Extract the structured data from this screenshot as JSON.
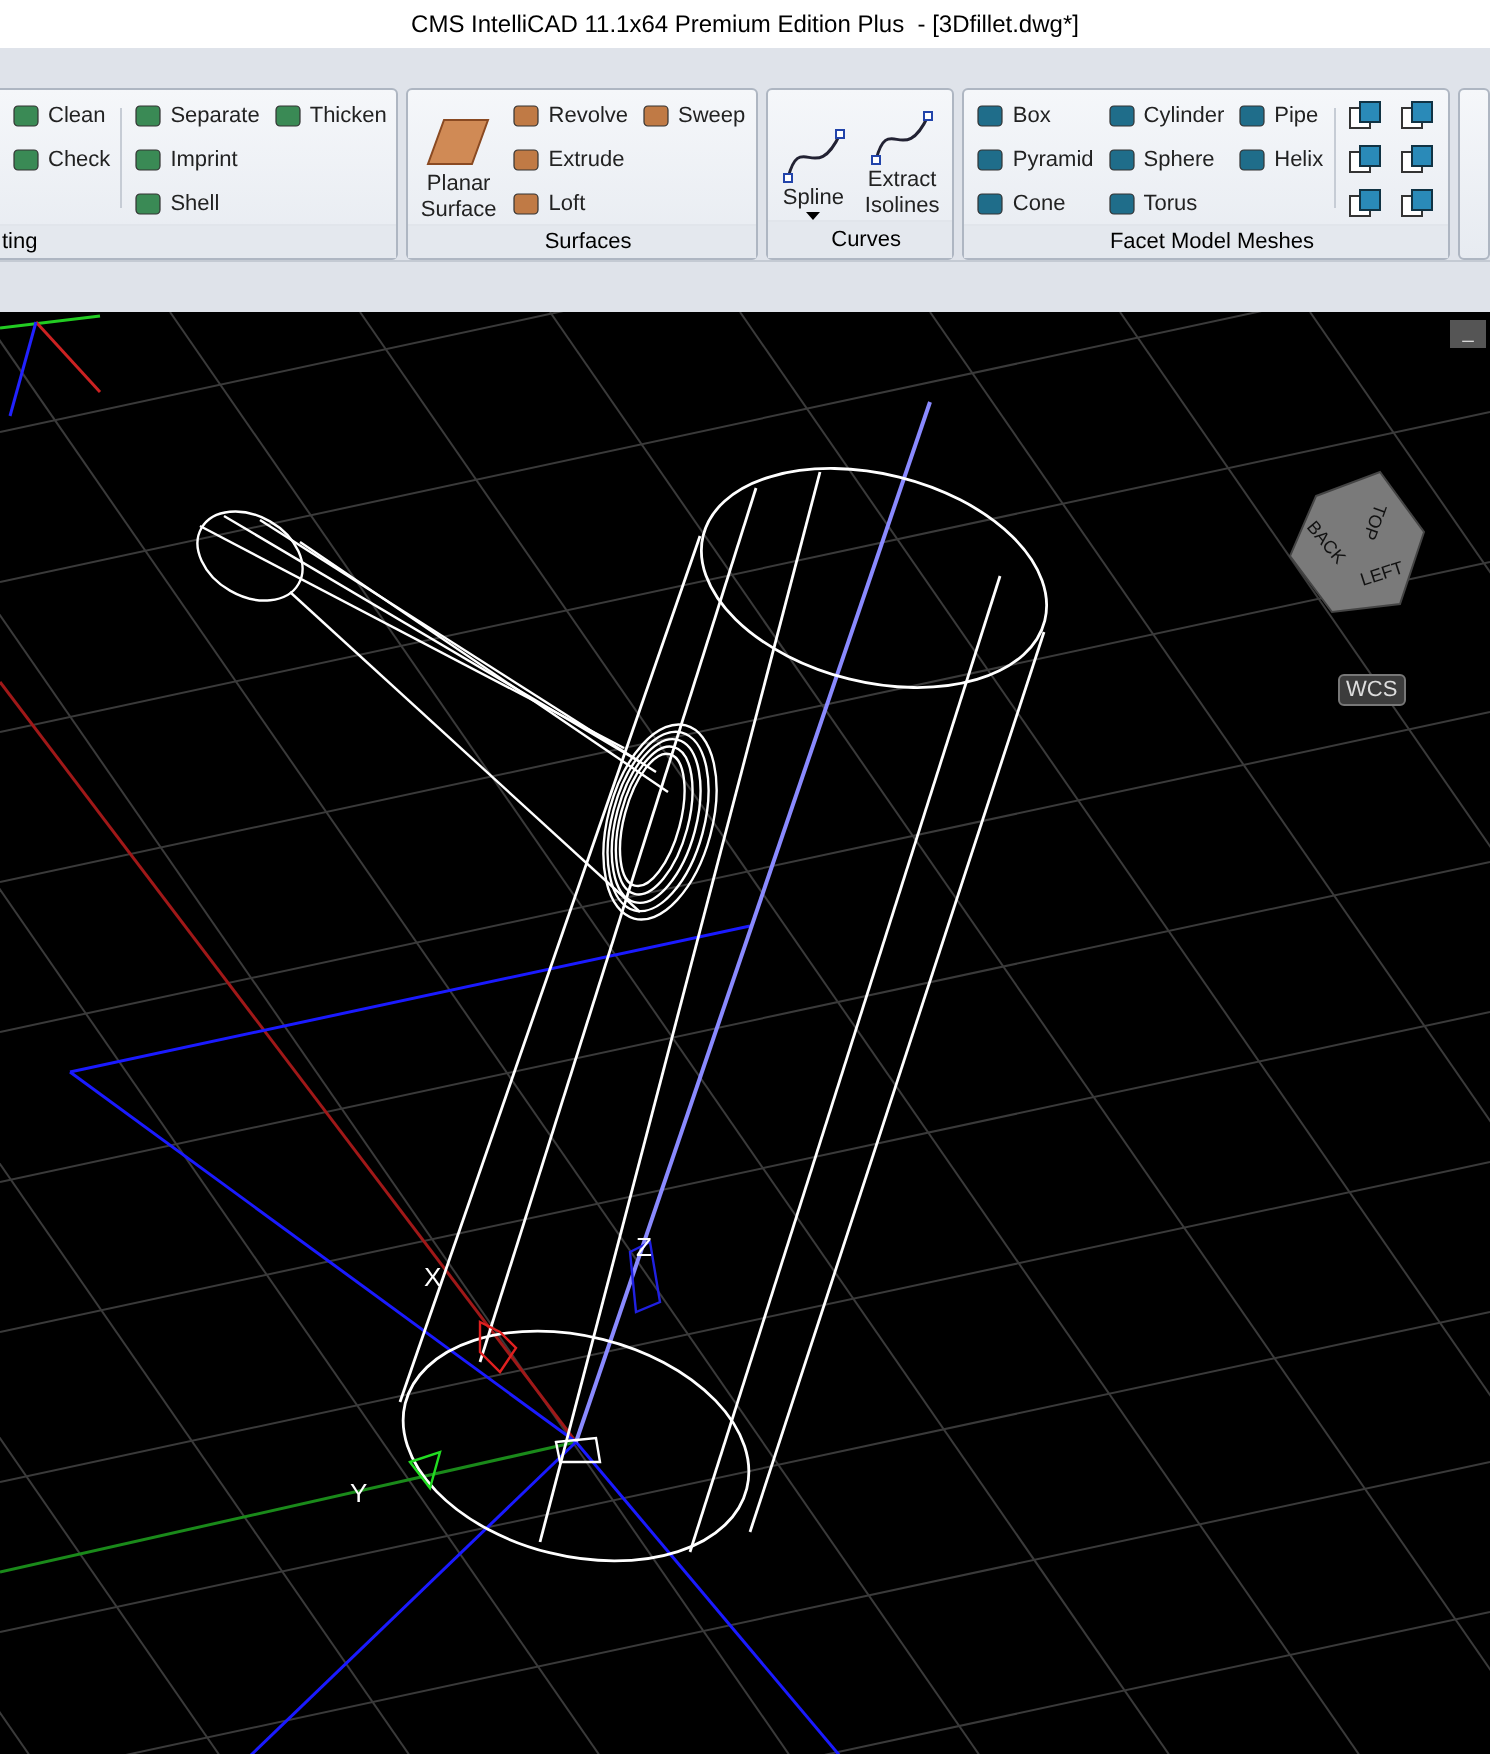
{
  "window": {
    "title": "CMS IntelliCAD 11.1x64 Premium Edition Plus  - [3Dfillet.dwg*]"
  },
  "ribbon": {
    "groups": [
      {
        "label": "ting",
        "partial": true,
        "columns": [
          [
            {
              "kind": "small",
              "label": "Clean"
            },
            {
              "kind": "small",
              "label": "Check"
            }
          ],
          [
            {
              "kind": "small",
              "label": "Separate"
            },
            {
              "kind": "small",
              "label": "Imprint"
            },
            {
              "kind": "small",
              "label": "Shell"
            }
          ],
          [
            {
              "kind": "small",
              "label": "Thicken"
            }
          ]
        ]
      },
      {
        "label": "Surfaces",
        "partial": false,
        "columns": [
          [
            {
              "kind": "large",
              "label": "Planar Surface"
            }
          ],
          [
            {
              "kind": "small",
              "label": "Revolve"
            },
            {
              "kind": "small",
              "label": "Extrude"
            },
            {
              "kind": "small",
              "label": "Loft"
            }
          ],
          [
            {
              "kind": "small",
              "label": "Sweep"
            }
          ]
        ]
      },
      {
        "label": "Curves",
        "partial": false,
        "columns": [
          [
            {
              "kind": "large",
              "label": "Spline",
              "dropdown": true
            }
          ],
          [
            {
              "kind": "large",
              "label": "Extract Isolines"
            }
          ]
        ]
      },
      {
        "label": "Facet Model Meshes",
        "partial": false,
        "columns": [
          [
            {
              "kind": "small",
              "label": "Box"
            },
            {
              "kind": "small",
              "label": "Pyramid"
            },
            {
              "kind": "small",
              "label": "Cone"
            }
          ],
          [
            {
              "kind": "small",
              "label": "Cylinder"
            },
            {
              "kind": "small",
              "label": "Sphere"
            },
            {
              "kind": "small",
              "label": "Torus"
            }
          ],
          [
            {
              "kind": "small",
              "label": "Pipe"
            },
            {
              "kind": "small",
              "label": "Helix"
            }
          ],
          [
            {
              "kind": "icon"
            },
            {
              "kind": "icon"
            },
            {
              "kind": "icon"
            }
          ],
          [
            {
              "kind": "icon"
            },
            {
              "kind": "icon"
            },
            {
              "kind": "icon"
            }
          ]
        ]
      }
    ]
  },
  "viewport": {
    "minimize": "_",
    "viewcube": {
      "top": "TOP",
      "back": "BACK",
      "left": "LEFT"
    },
    "ucs_badge": "WCS",
    "axis_labels": {
      "x": "X",
      "y": "Y",
      "z": "Z"
    }
  }
}
